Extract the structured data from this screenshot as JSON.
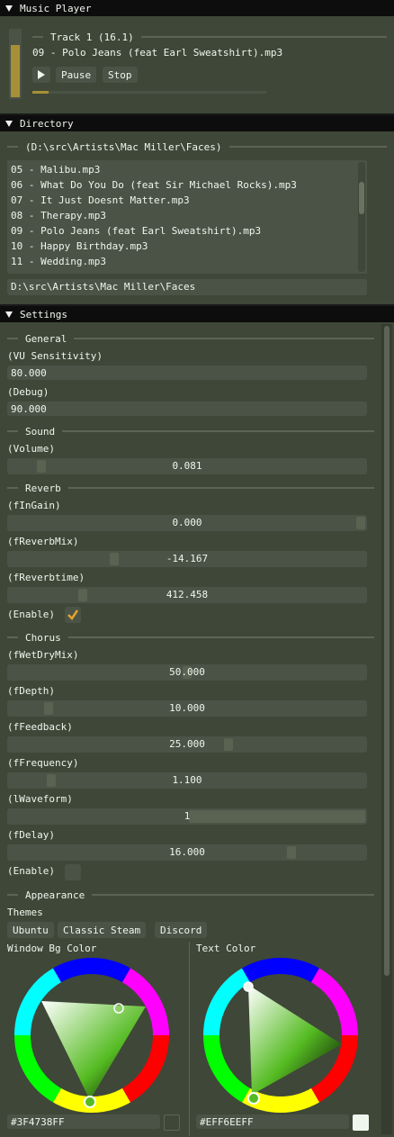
{
  "music_player": {
    "title": "Music Player",
    "track_header": "Track 1 (16.1)",
    "now_playing": "09 - Polo Jeans (feat Earl Sweatshirt).mp3",
    "play_icon": "play-icon",
    "pause_label": "Pause",
    "stop_label": "Stop",
    "vu_level": 0.78,
    "progress": 0.07
  },
  "directory": {
    "title": "Directory",
    "path_header": "(D:\\src\\Artists\\Mac Miller\\Faces)",
    "files": [
      "05 - Malibu.mp3",
      "06 - What Do You Do (feat Sir Michael Rocks).mp3",
      "07 - It Just Doesnt Matter.mp3",
      "08 - Therapy.mp3",
      "09 - Polo Jeans (feat Earl Sweatshirt).mp3",
      "10 - Happy Birthday.mp3",
      "11 - Wedding.mp3"
    ],
    "path_value": "D:\\src\\Artists\\Mac Miller\\Faces"
  },
  "settings": {
    "title": "Settings",
    "general": {
      "header": "General",
      "vu_label": "(VU Sensitivity)",
      "vu_value": "80.000",
      "debug_label": "(Debug)",
      "debug_value": "90.000"
    },
    "sound": {
      "header": "Sound",
      "volume_label": "(Volume)",
      "volume_value": "0.081",
      "volume_pos": 0.081
    },
    "reverb": {
      "header": "Reverb",
      "ingain_label": "(fInGain)",
      "ingain_value": "0.000",
      "ingain_pos": 1.0,
      "mix_label": "(fReverbMix)",
      "mix_value": "-14.167",
      "mix_pos": 0.29,
      "time_label": "(fReverbtime)",
      "time_value": "412.458",
      "time_pos": 0.2,
      "enable_label": "(Enable)",
      "enabled": true
    },
    "chorus": {
      "header": "Chorus",
      "wetdry_label": "(fWetDryMix)",
      "wetdry_value": "50.000",
      "wetdry_pos": 0.5,
      "depth_label": "(fDepth)",
      "depth_value": "10.000",
      "depth_pos": 0.1,
      "feedback_label": "(fFeedback)",
      "feedback_value": "25.000",
      "feedback_pos": 0.62,
      "frequency_label": "(fFrequency)",
      "frequency_value": "1.100",
      "frequency_pos": 0.11,
      "waveform_label": "(lWaveform)",
      "waveform_value": "1",
      "waveform_pos": 1.0,
      "delay_label": "(fDelay)",
      "delay_value": "16.000",
      "delay_pos": 0.8,
      "enable_label": "(Enable)",
      "enabled": false
    },
    "appearance": {
      "header": "Appearance",
      "themes_label": "Themes",
      "themes": [
        "Ubuntu",
        "Classic Steam",
        "Discord"
      ],
      "window_bg_label": "Window Bg Color",
      "window_bg_hex": "#3F4738FF",
      "window_bg_color": "#3F4738",
      "text_color_label": "Text Color",
      "text_color_hex": "#EFF6EEFF",
      "text_color": "#EFF6EE"
    }
  }
}
